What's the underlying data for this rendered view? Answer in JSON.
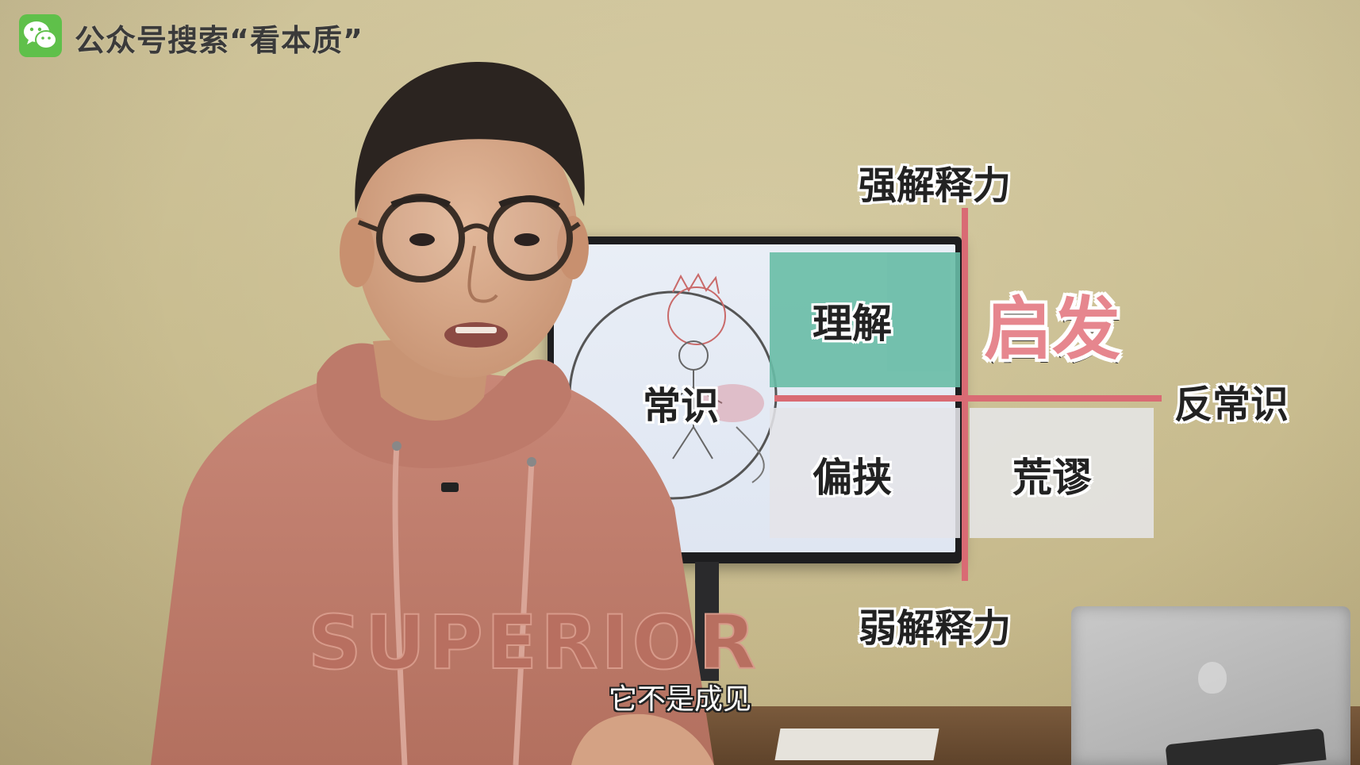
{
  "watermark": {
    "icon": "wechat-icon",
    "text": "公众号搜索“看本质”"
  },
  "diagram": {
    "axis_top": "强解释力",
    "axis_bottom": "弱解释力",
    "axis_left": "常识",
    "axis_right": "反常识",
    "quadrant_top_left": "理解",
    "quadrant_top_right": "启发",
    "quadrant_bottom_left": "偏挟",
    "quadrant_bottom_right": "荒谬",
    "colors": {
      "axis": "#d96b74",
      "quadrant_top_left": "#68bca6",
      "quadrant_bottom": "#e4e4e8",
      "highlight_text": "#e6868e"
    }
  },
  "hoodie_print": "SUPERIOR",
  "subtitle": "它不是成见"
}
